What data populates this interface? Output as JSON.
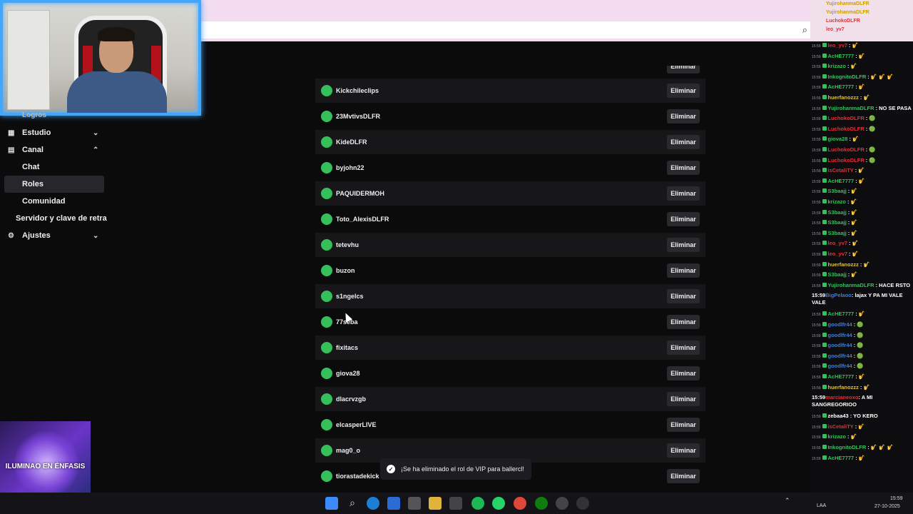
{
  "sidebar": {
    "items": [
      {
        "label": "Logros"
      },
      {
        "label": "Estudio"
      },
      {
        "label": "Canal"
      },
      {
        "label": "Chat"
      },
      {
        "label": "Roles"
      },
      {
        "label": "Comunidad"
      },
      {
        "label": "Servidor y clave de retrans"
      },
      {
        "label": "Ajustes"
      }
    ]
  },
  "list": {
    "remove_label": "Eliminar",
    "rows": [
      {
        "name": "Kickchileclips"
      },
      {
        "name": "23MvtivsDLFR"
      },
      {
        "name": "KideDLFR"
      },
      {
        "name": "byjohn22"
      },
      {
        "name": "PAQUIDERMOH"
      },
      {
        "name": "Toto_AlexisDLFR"
      },
      {
        "name": "tetevhu"
      },
      {
        "name": "buzon"
      },
      {
        "name": "s1ngelcs"
      },
      {
        "name": "77seba"
      },
      {
        "name": "fixitacs"
      },
      {
        "name": "giova28"
      },
      {
        "name": "dlacrvzgb"
      },
      {
        "name": "elcasperLIVE"
      },
      {
        "name": "mag0_o"
      },
      {
        "name": "tiorastadekick"
      }
    ]
  },
  "toast": {
    "text": "¡Se ha eliminado el rol de VIP para ballercl!"
  },
  "chat": {
    "top": [
      "YujirohanmaDLFR",
      "YujirohanmaDLFR",
      "LuchokoDLFR",
      "leo_yv7"
    ],
    "lines": [
      {
        "ts": "15:59",
        "user": "leo_yv7",
        "color": "#e0313a",
        "msg": ": 🎷"
      },
      {
        "ts": "15:59",
        "user": "AcHE7777",
        "color": "#35c05c",
        "msg": ": 🎷"
      },
      {
        "ts": "15:59",
        "user": "krizazo",
        "color": "#35c05c",
        "msg": ": 🎷"
      },
      {
        "ts": "15:59",
        "user": "InkognitoDLFR",
        "color": "#35c05c",
        "msg": ": 🎷 🎷 🎷"
      },
      {
        "ts": "15:59",
        "user": "AcHE7777",
        "color": "#35c05c",
        "msg": ": 🎷"
      },
      {
        "ts": "15:59",
        "user": "huerfanozzz",
        "color": "#e0c03a",
        "msg": ": 🎷"
      },
      {
        "ts": "15:59",
        "user": "YujirohanmaDLFR",
        "color": "#35c05c",
        "msg": ": NO SE PASA"
      },
      {
        "ts": "15:59",
        "user": "LuchokoDLFR",
        "color": "#e0313a",
        "msg": ": 🟢"
      },
      {
        "ts": "15:59",
        "user": "LuchokoDLFR",
        "color": "#e0313a",
        "msg": ": 🟢"
      },
      {
        "ts": "15:59",
        "user": "giova28",
        "color": "#35c05c",
        "msg": ": 🎷"
      },
      {
        "ts": "15:59",
        "user": "LuchokoDLFR",
        "color": "#e0313a",
        "msg": ": 🟢"
      },
      {
        "ts": "15:59",
        "user": "LuchokoDLFR",
        "color": "#e0313a",
        "msg": ": 🟢"
      },
      {
        "ts": "15:59",
        "user": "isCetaliTY",
        "color": "#e0313a",
        "msg": ": 🎷"
      },
      {
        "ts": "15:59",
        "user": "AcHE7777",
        "color": "#35c05c",
        "msg": ": 🎷"
      },
      {
        "ts": "15:59",
        "user": "S3baajj",
        "color": "#35c05c",
        "msg": ": 🎷"
      },
      {
        "ts": "15:59",
        "user": "krizazo",
        "color": "#35c05c",
        "msg": ": 🎷"
      },
      {
        "ts": "15:59",
        "user": "S3baajj",
        "color": "#35c05c",
        "msg": ": 🎷"
      },
      {
        "ts": "15:59",
        "user": "S3baajj",
        "color": "#35c05c",
        "msg": ": 🎷"
      },
      {
        "ts": "15:59",
        "user": "S3baajj",
        "color": "#35c05c",
        "msg": ": 🎷"
      },
      {
        "ts": "15:59",
        "user": "leo_yv7",
        "color": "#e0313a",
        "msg": ": 🎷"
      },
      {
        "ts": "15:59",
        "user": "leo_yv7",
        "color": "#e0313a",
        "msg": ": 🎷"
      },
      {
        "ts": "15:59",
        "user": "huerfanozzz",
        "color": "#e0c03a",
        "msg": ": 🎷"
      },
      {
        "ts": "15:59",
        "user": "S3baajj",
        "color": "#35c05c",
        "msg": ": 🎷"
      },
      {
        "ts": "15:59",
        "user": "YujirohanmaDLFR",
        "color": "#35c05c",
        "msg": ": HACE RSTO"
      },
      {
        "ts": "15:59",
        "user": "BigPelaoo",
        "color": "#3a7ee0",
        "msg": ": lajax Y PA MI VALE VALE"
      },
      {
        "ts": "15:59",
        "user": "AcHE7777",
        "color": "#35c05c",
        "msg": ": 🎷"
      },
      {
        "ts": "15:59",
        "user": "goodlfr44",
        "color": "#3a7ee0",
        "msg": ": 🟢"
      },
      {
        "ts": "15:59",
        "user": "goodlfr44",
        "color": "#3a7ee0",
        "msg": ": 🟢"
      },
      {
        "ts": "15:59",
        "user": "goodlfr44",
        "color": "#3a7ee0",
        "msg": ": 🟢"
      },
      {
        "ts": "15:59",
        "user": "goodlfr44",
        "color": "#3a7ee0",
        "msg": ": 🟢"
      },
      {
        "ts": "15:59",
        "user": "goodlfr44",
        "color": "#3a7ee0",
        "msg": ": 🟢"
      },
      {
        "ts": "15:59",
        "user": "AcHE7777",
        "color": "#35c05c",
        "msg": ": 🎷"
      },
      {
        "ts": "15:59",
        "user": "huerfanozzz",
        "color": "#e0c03a",
        "msg": ": 🎷"
      },
      {
        "ts": "15:59",
        "user": "marcianeoxo",
        "color": "#e0313a",
        "msg": ": A MI SANGREGORIOO"
      },
      {
        "ts": "15:59",
        "user": "zebaa43",
        "color": "#fff",
        "msg": ": YO KERO"
      },
      {
        "ts": "15:59",
        "user": "isCetaliTY",
        "color": "#e0313a",
        "msg": ": 🎷"
      },
      {
        "ts": "15:59",
        "user": "krizazo",
        "color": "#35c05c",
        "msg": ": 🎷"
      },
      {
        "ts": "15:59",
        "user": "InkognitoDLFR",
        "color": "#35c05c",
        "msg": ": 🎷 🎷 🎷"
      },
      {
        "ts": "15:59",
        "user": "AcHE7777",
        "color": "#35c05c",
        "msg": ": 🎷"
      }
    ]
  },
  "ad": {
    "title": "ILUMINAO EN ÉNFASIS"
  },
  "taskbar": {
    "lang": "LAA",
    "time": "15:59",
    "date": "27-10-2025"
  }
}
